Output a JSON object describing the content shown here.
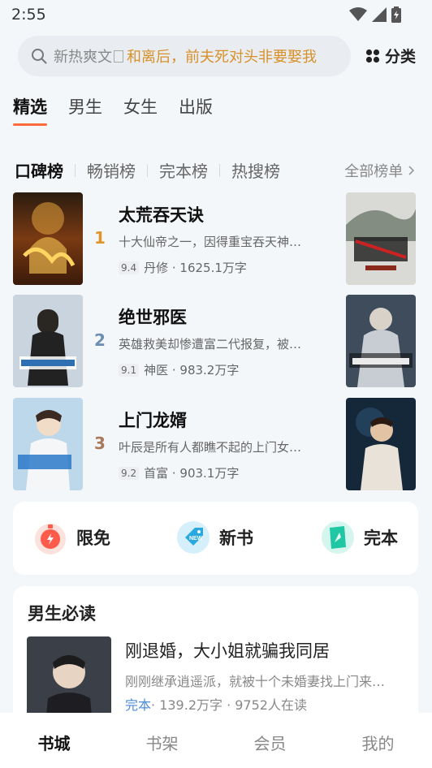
{
  "status": {
    "time": "2:55"
  },
  "search": {
    "placeholder": "新热爽文",
    "hot_term": "和离后，前夫死对头非要娶我"
  },
  "category": {
    "label": "分类"
  },
  "top_tabs": [
    {
      "label": "精选"
    },
    {
      "label": "男生"
    },
    {
      "label": "女生"
    },
    {
      "label": "出版"
    }
  ],
  "rank_tabs": [
    {
      "label": "口碑榜"
    },
    {
      "label": "畅销榜"
    },
    {
      "label": "完本榜"
    },
    {
      "label": "热搜榜"
    }
  ],
  "rank_all": "全部榜单",
  "books": [
    {
      "rank": "1",
      "title": "太荒吞天诀",
      "desc": "十大仙帝之一，因得重宝吞天神…",
      "score": "9.4",
      "meta": "丹修 · 1625.1万字",
      "rank_color": "#e0952b"
    },
    {
      "rank": "2",
      "title": "绝世邪医",
      "desc": "英雄救美却惨遭富二代报复，被…",
      "score": "9.1",
      "meta": "神医 · 983.2万字",
      "rank_color": "#6c8fb3"
    },
    {
      "rank": "3",
      "title": "上门龙婿",
      "desc": "叶辰是所有人都瞧不起的上门女…",
      "score": "9.2",
      "meta": "首富 · 903.1万字",
      "rank_color": "#a8795a"
    }
  ],
  "quick": [
    {
      "label": "限免",
      "icon": "stopwatch-icon"
    },
    {
      "label": "新书",
      "icon": "new-tag-icon"
    },
    {
      "label": "完本",
      "icon": "book-icon"
    }
  ],
  "must_read": {
    "title": "男生必读",
    "book_title": "刚退婚，大小姐就骗我同居",
    "desc": "刚刚继承逍遥派，就被十个未婚妻找上门来…",
    "status": "完本",
    "meta": "· 139.2万字 · 9752人在读"
  },
  "bottom_nav": [
    {
      "label": "书城"
    },
    {
      "label": "书架"
    },
    {
      "label": "会员"
    },
    {
      "label": "我的"
    }
  ]
}
